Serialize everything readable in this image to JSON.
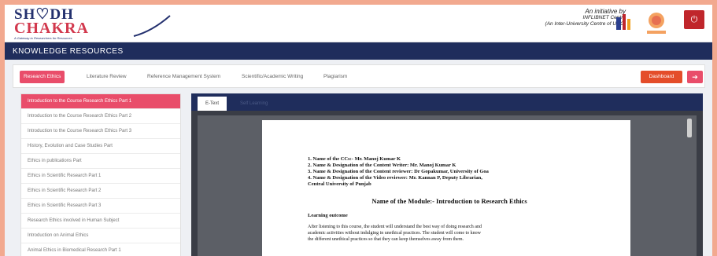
{
  "header": {
    "logo_top": "SH♡DH",
    "logo_bottom": "CHAKRA",
    "logo_tagline": "A Gateway to Researchers for Resources",
    "initiative_line1": "An initiative by",
    "initiative_line2": "INFLIBNET Centre",
    "initiative_line3": "(An Inter-University Centre of UGC)",
    "power_icon": "⏻"
  },
  "titlebar": {
    "title": "KNOWLEDGE RESOURCES"
  },
  "tabs": [
    {
      "label": "Research Ethics"
    },
    {
      "label": "Literature Review"
    },
    {
      "label": "Reference Management System"
    },
    {
      "label": "Scientific/Academic Writing"
    },
    {
      "label": "Plagiarism"
    }
  ],
  "actions": {
    "dashboard_label": "Dashboard",
    "back_icon": "➔"
  },
  "list_items": [
    {
      "label": "Introduction to the Course Research Ethics Part 1"
    },
    {
      "label": "Introduction to the Course Research Ethics Part 2"
    },
    {
      "label": "Introduction to the Course Research Ethics Part 3"
    },
    {
      "label": "History, Evolution and Case Studies Part"
    },
    {
      "label": "Ethics in publications Part"
    },
    {
      "label": "Ethics in Scientific Research Part 1"
    },
    {
      "label": "Ethics in Scientific Research Part 2"
    },
    {
      "label": "Ethics in Scientific Research Part 3"
    },
    {
      "label": "Research Ethics involved in Human Subject"
    },
    {
      "label": "Introduction on Animal Ethics"
    },
    {
      "label": "Animal Ethics in Biomedical Research Part 1"
    }
  ],
  "viewer": {
    "tab_etext": "E-Text",
    "tab_self_learning": "Self Learning",
    "doc_lines": [
      "1. Name of the CCs:- Mr. Manoj Kumar K",
      "2. Name & Designation of the Content Writer: Mr. Manoj Kumar K",
      "3. Name & Designation of the Content reviewer: Dr Gopakumar, University of Goa",
      "4. Name & Designation of the Video reviewer: Mr. Kannan P, Deputy Librarian,",
      "Central University of Punjab"
    ],
    "module_title": "Name of the Module:- Introduction to Research Ethics",
    "outcome_heading": "Learning outcome",
    "outcome_lines": [
      "After listening to this course, the student will understand the best way of doing research and",
      "academic activities without indulging in unethical practices. The student will come to know",
      "the different unethical practices so that they can keep themselves away from them."
    ]
  },
  "colors": {
    "accent": "#e94d6a",
    "navy": "#1f2d5c",
    "dashboard": "#e44d2a",
    "power": "#c0262b"
  }
}
